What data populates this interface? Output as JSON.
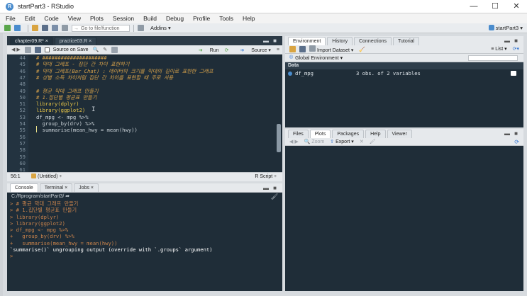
{
  "window": {
    "title": "startPart3 - RStudio",
    "controls": [
      "—",
      "☐",
      "✕"
    ]
  },
  "menu": [
    "File",
    "Edit",
    "Code",
    "View",
    "Plots",
    "Session",
    "Build",
    "Debug",
    "Profile",
    "Tools",
    "Help"
  ],
  "toolbar": {
    "goto_placeholder": "Go to file/function",
    "addins": "Addins ▾",
    "project": "startPart3 ▾"
  },
  "editor": {
    "tabs": [
      {
        "label": "chapter09.R* ×",
        "active": true
      },
      {
        "label": "practice03.R ×",
        "active": false
      }
    ],
    "toolbar": {
      "source_on_save": "Source on Save",
      "run": "Run",
      "source": "Source ▾"
    },
    "lines": [
      {
        "n": "44",
        "text": "# #####################",
        "cls": "cmt"
      },
      {
        "n": "45",
        "text": "# 막대 그래프 - 집단 간 차이 표현하기",
        "cls": "cmt"
      },
      {
        "n": "46",
        "text": "# 막대 그래프(Bar Chat) : 데이터의 크기를 막대의 길이로 표현한 그래프",
        "cls": "cmt"
      },
      {
        "n": "47",
        "text": "# 성별 소득 차이처럼 집단 간 차이를 표현할 때 주로 사용",
        "cls": "cmt"
      },
      {
        "n": "48",
        "text": "",
        "cls": "plain"
      },
      {
        "n": "49",
        "text": "# 평균 막대 그래프 만들기",
        "cls": "cmt"
      },
      {
        "n": "50",
        "text": "# 1.집단별 평균표 만들기",
        "cls": "cmt"
      },
      {
        "n": "51",
        "text": "library(dplyr)",
        "cls": "kw"
      },
      {
        "n": "52",
        "text": "library(ggplot2)",
        "cls": "kw"
      },
      {
        "n": "53",
        "text": "df_mpg <- mpg %>%",
        "cls": "plain"
      },
      {
        "n": "54",
        "text": "  group_by(drv) %>%",
        "cls": "plain"
      },
      {
        "n": "55",
        "text": "  summarise(mean_hwy = mean(hwy))",
        "cls": "plain"
      },
      {
        "n": "56",
        "text": "",
        "cls": "plain"
      },
      {
        "n": "57",
        "text": "",
        "cls": "plain"
      },
      {
        "n": "58",
        "text": "",
        "cls": "plain"
      },
      {
        "n": "59",
        "text": "",
        "cls": "plain"
      },
      {
        "n": "60",
        "text": "",
        "cls": "plain"
      },
      {
        "n": "61",
        "text": "",
        "cls": "plain"
      }
    ],
    "status": {
      "position": "56:1",
      "scope": "(Untitled) ÷",
      "filetype": "R Script ÷"
    }
  },
  "console": {
    "tabs": [
      {
        "label": "Console",
        "active": true
      },
      {
        "label": "Terminal ×",
        "active": false
      },
      {
        "label": "Jobs ×",
        "active": false
      }
    ],
    "path": "C:/Rprogram/startPart3/ ➦",
    "lines": [
      {
        "text": "> # 평균 막대 그래프 만들기",
        "cls": "con-in"
      },
      {
        "text": "> # 1.집단별 평균표 만들기",
        "cls": "con-in"
      },
      {
        "text": "> library(dplyr)",
        "cls": "con-in"
      },
      {
        "text": "> library(ggplot2)",
        "cls": "con-in"
      },
      {
        "text": "> df_mpg <- mpg %>%",
        "cls": "con-in"
      },
      {
        "text": "+   group_by(drv) %>%",
        "cls": "con-in"
      },
      {
        "text": "+   summarise(mean_hwy = mean(hwy))",
        "cls": "con-in"
      },
      {
        "text": "`summarise()` ungrouping output (override with `.groups` argument)",
        "cls": "con-out"
      },
      {
        "text": "> ",
        "cls": "con-prompt"
      }
    ]
  },
  "env": {
    "tabs": [
      {
        "label": "Environment",
        "active": true
      },
      {
        "label": "History",
        "active": false
      },
      {
        "label": "Connections",
        "active": false
      },
      {
        "label": "Tutorial",
        "active": false
      }
    ],
    "import": "Import Dataset ▾",
    "view_mode": "≡ List ▾",
    "scope": "Global Environment ▾",
    "section": "Data",
    "rows": [
      {
        "name": "df_mpg",
        "value": "3 obs. of 2 variables"
      }
    ]
  },
  "files": {
    "tabs": [
      {
        "label": "Files",
        "active": false
      },
      {
        "label": "Plots",
        "active": true
      },
      {
        "label": "Packages",
        "active": false
      },
      {
        "label": "Help",
        "active": false
      },
      {
        "label": "Viewer",
        "active": false
      }
    ],
    "zoom": "Zoom",
    "export": "Export ▾"
  }
}
